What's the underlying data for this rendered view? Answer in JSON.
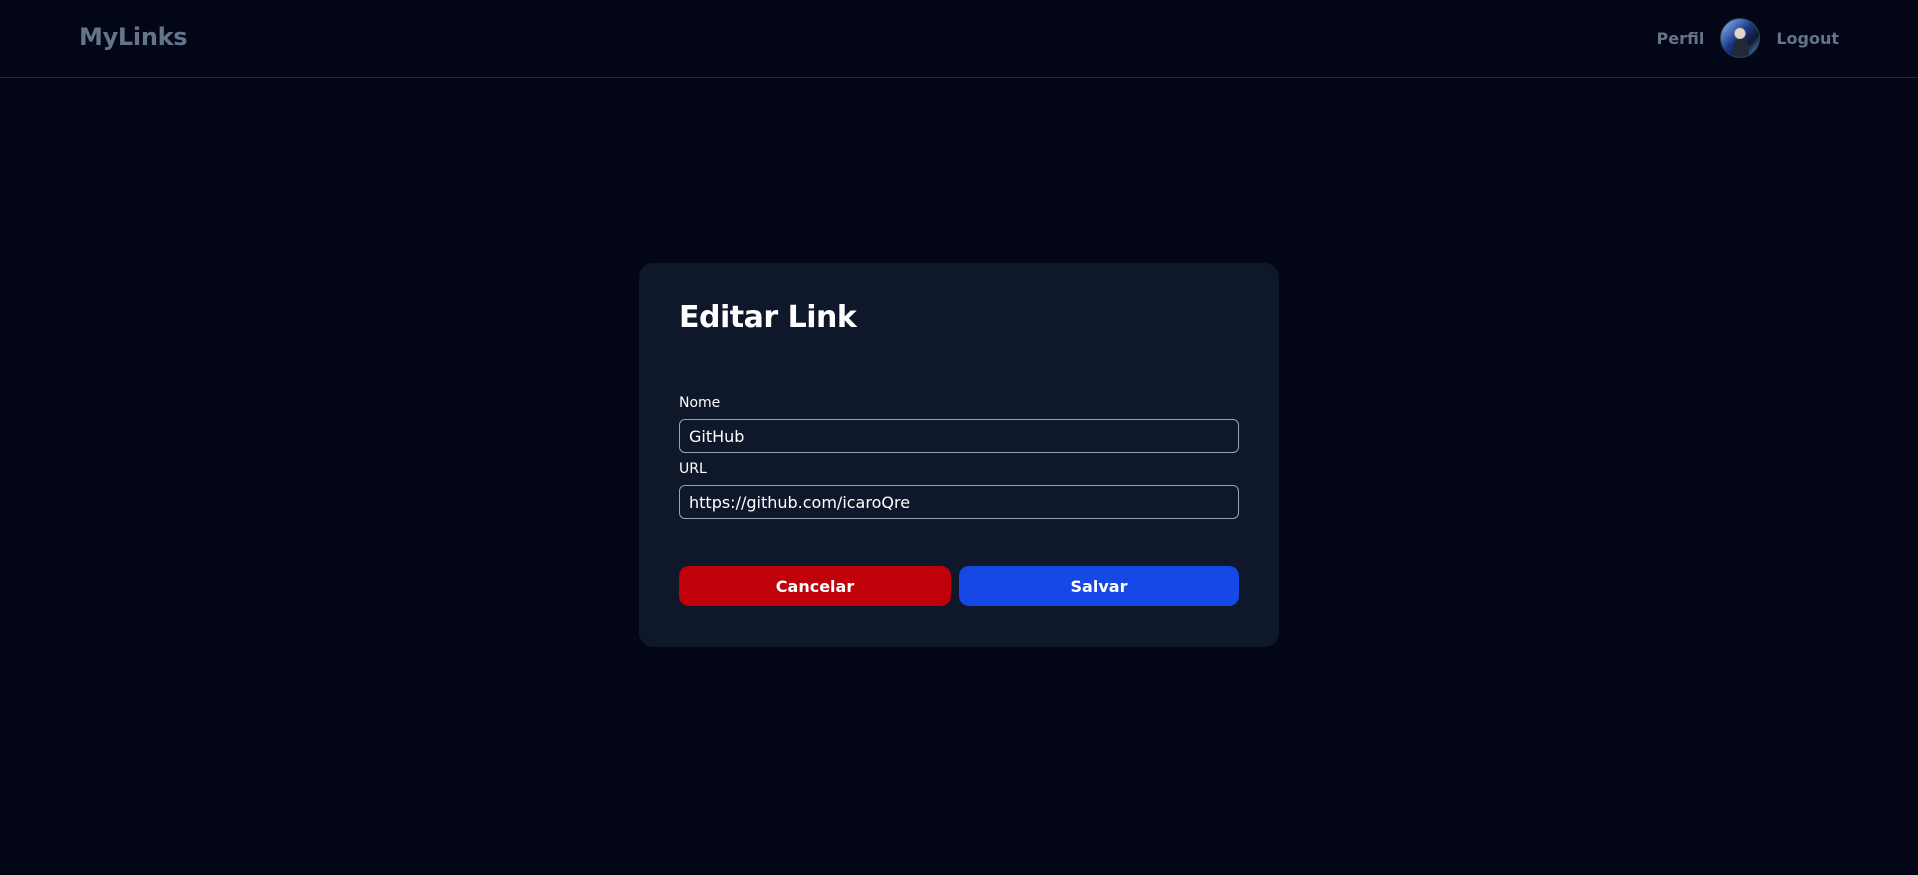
{
  "navbar": {
    "brand": "MyLinks",
    "profile_label": "Perfil",
    "logout_label": "Logout"
  },
  "form": {
    "title": "Editar Link",
    "name_label": "Nome",
    "name_value": "GitHub",
    "url_label": "URL",
    "url_value": "https://github.com/icaroQre",
    "cancel_label": "Cancelar",
    "save_label": "Salvar"
  },
  "colors": {
    "background": "#020617",
    "card": "#0f172a",
    "cancel": "#c0000a",
    "save": "#1648e5",
    "muted_text": "#64748b"
  }
}
